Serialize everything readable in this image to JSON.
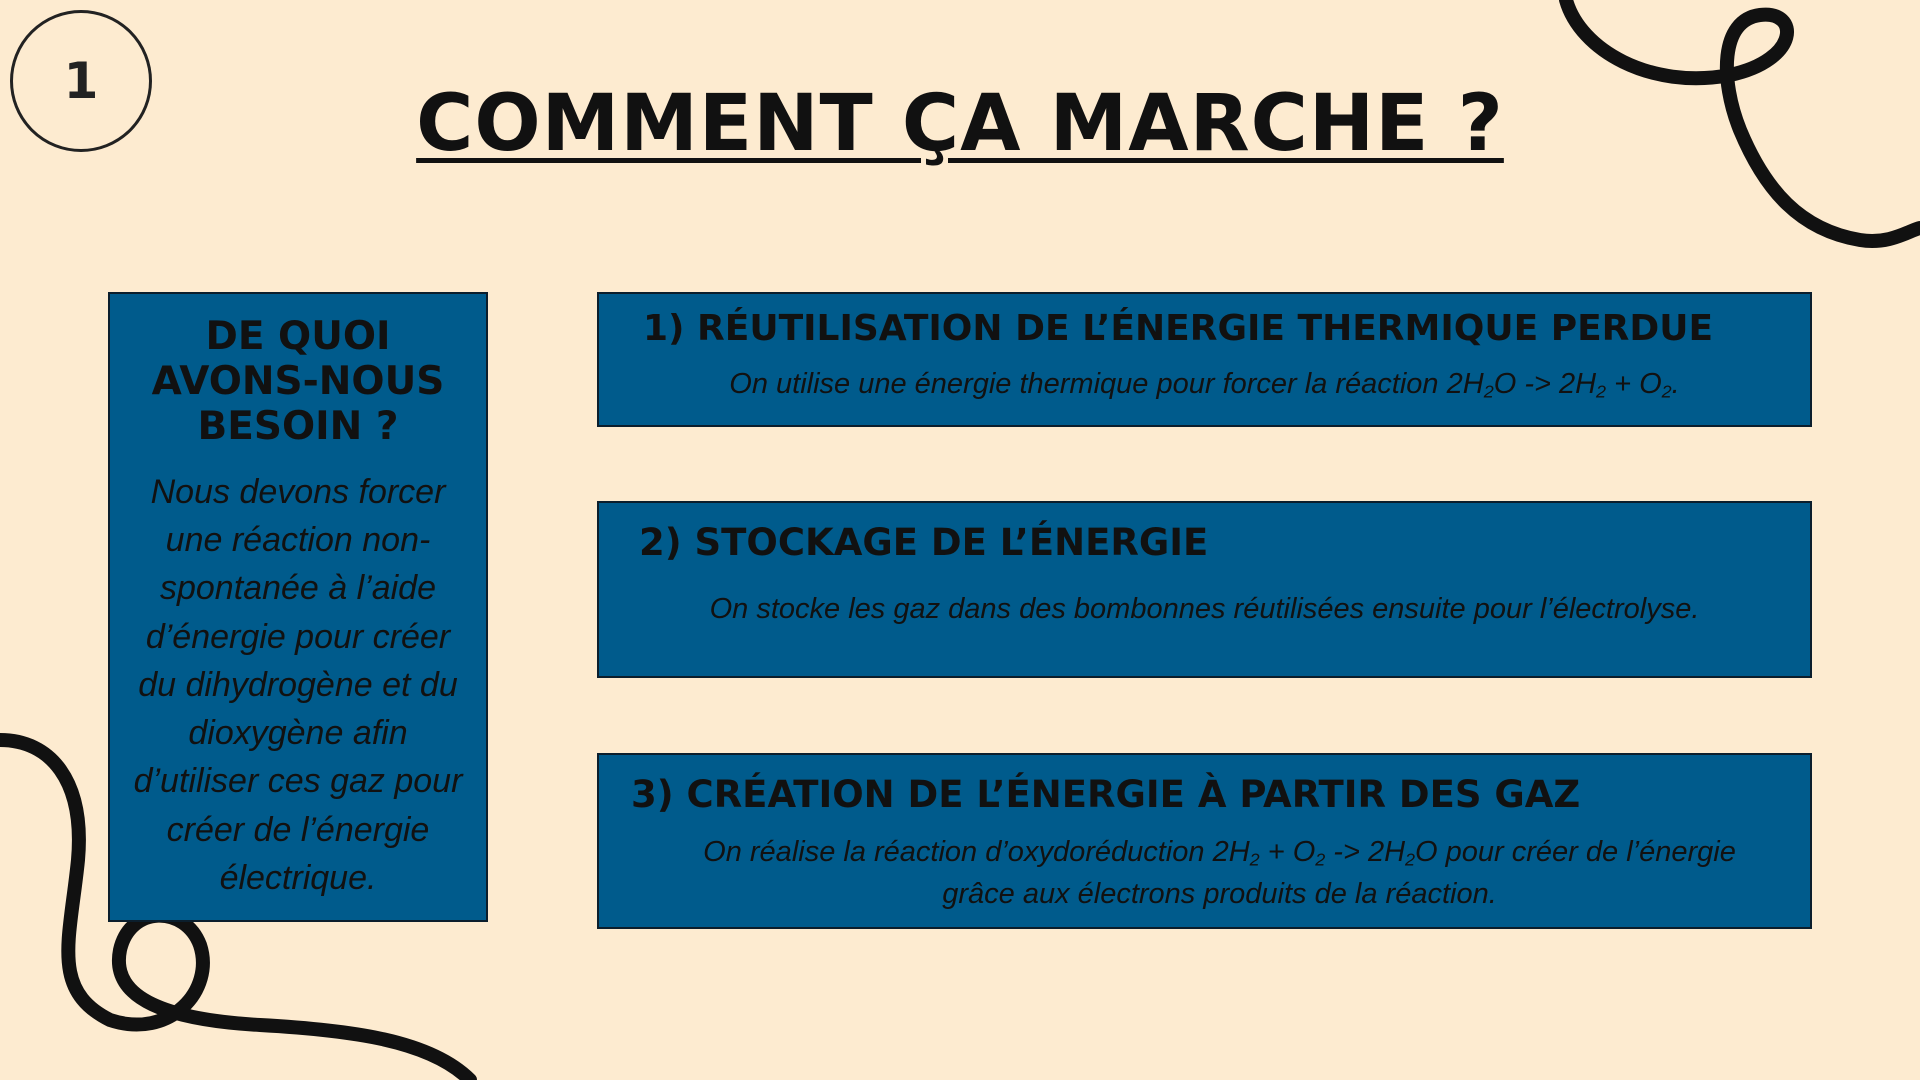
{
  "page_number": "1",
  "title": "COMMENT ÇA MARCHE ?",
  "needs": {
    "title": "DE QUOI AVONS-NOUS BESOIN ?",
    "body": "Nous devons forcer une réaction non-spontanée à l’aide d’énergie pour créer du dihydrogène et du dioxygène afin d’utiliser ces gaz pour créer de l’énergie électrique."
  },
  "steps": [
    {
      "title": "1) RÉUTILISATION DE L’ÉNERGIE THERMIQUE PERDUE",
      "desc_prefix": "On utilise une énergie thermique pour forcer la réaction ",
      "equation": "2H2O -> 2H2 + O2",
      "desc_suffix": "."
    },
    {
      "title": "2) STOCKAGE DE L’ÉNERGIE",
      "desc": "On stocke les gaz dans des bombonnes réutilisées ensuite pour l’électrolyse."
    },
    {
      "title": "3) CRÉATION DE L’ÉNERGIE À PARTIR DES GAZ",
      "desc_prefix": "On réalise la réaction d’oxydoréduction ",
      "equation": "2H2 + O2 -> 2H2O",
      "desc_suffix": " pour créer de l’énergie grâce aux électrons produits de la réaction."
    }
  ],
  "colors": {
    "background": "#fdebd0",
    "box": "#005b8c",
    "text": "#111111"
  }
}
